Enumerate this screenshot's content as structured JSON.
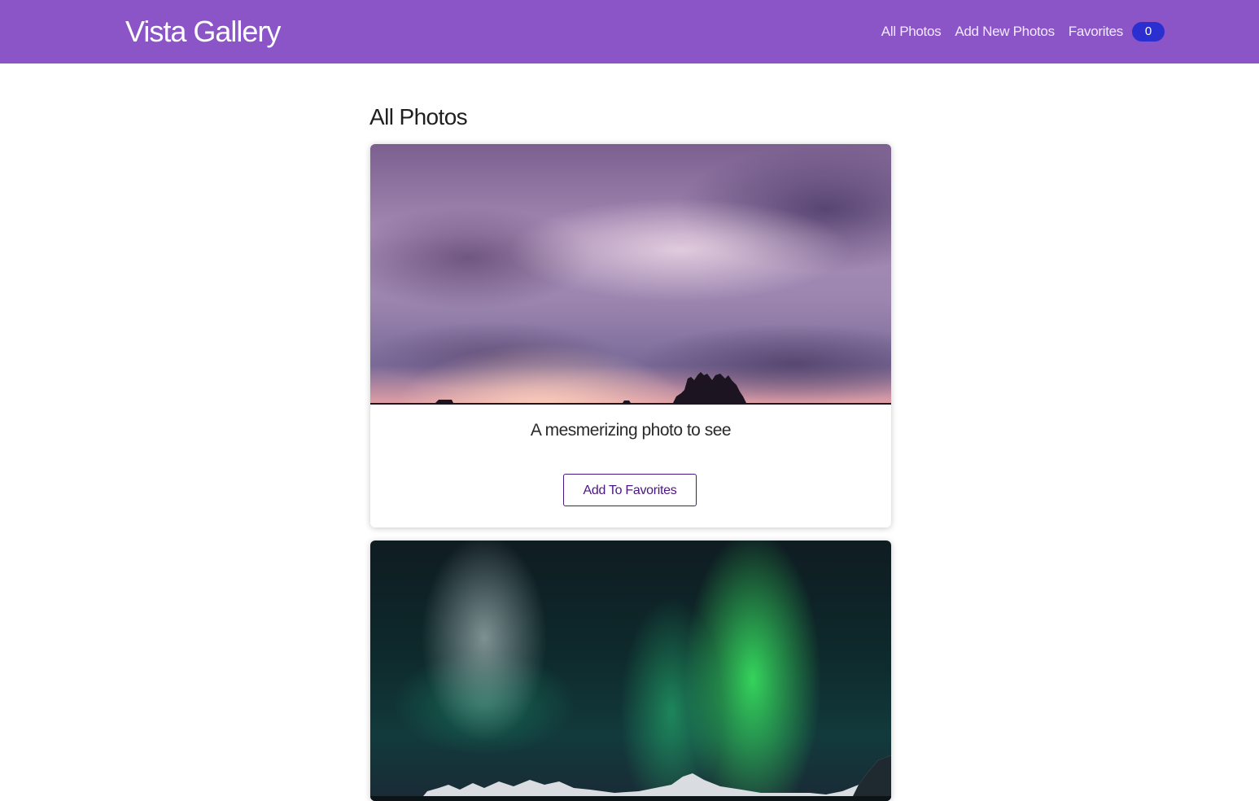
{
  "navbar": {
    "brand": "Vista Gallery",
    "links": [
      {
        "label": "All Photos"
      },
      {
        "label": "Add New Photos"
      },
      {
        "label": "Favorites"
      }
    ],
    "favorites_count": "0",
    "colors": {
      "background": "#8b55c8",
      "badge": "#2b2fd0"
    }
  },
  "main": {
    "title": "All Photos",
    "photos": [
      {
        "caption": "A mesmerizing photo to see",
        "button_label": "Add To Favorites",
        "image_subject": "purple sunset sky with castle silhouette"
      },
      {
        "image_subject": "green aurora over snowy mountains"
      }
    ]
  },
  "accent_color": "#4a1682"
}
